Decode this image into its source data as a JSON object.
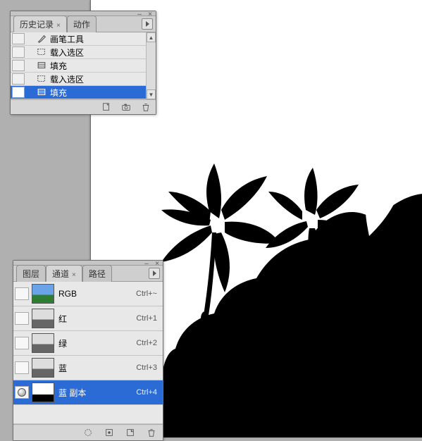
{
  "history_panel": {
    "tabs": [
      {
        "label": "历史记录",
        "active": true,
        "closeable": true
      },
      {
        "label": "动作",
        "active": false,
        "closeable": false
      }
    ],
    "items": [
      {
        "icon": "brush",
        "label": "画笔工具",
        "selected": false,
        "marker": ""
      },
      {
        "icon": "selection",
        "label": "载入选区",
        "selected": false,
        "marker": ""
      },
      {
        "icon": "fill",
        "label": "填充",
        "selected": false,
        "marker": ""
      },
      {
        "icon": "selection",
        "label": "载入选区",
        "selected": false,
        "marker": ""
      },
      {
        "icon": "fill",
        "label": "填充",
        "selected": true,
        "marker": "▶"
      }
    ],
    "footer_icons": [
      "new-doc-icon",
      "camera-icon",
      "trash-icon"
    ]
  },
  "channels_panel": {
    "tabs": [
      {
        "label": "图层",
        "active": false
      },
      {
        "label": "通道",
        "active": true,
        "closeable": true
      },
      {
        "label": "路径",
        "active": false
      }
    ],
    "items": [
      {
        "visible": false,
        "name": "RGB",
        "shortcut": "Ctrl+~",
        "selected": false,
        "thumb": "rgb"
      },
      {
        "visible": false,
        "name": "红",
        "shortcut": "Ctrl+1",
        "selected": false,
        "thumb": "gray"
      },
      {
        "visible": false,
        "name": "绿",
        "shortcut": "Ctrl+2",
        "selected": false,
        "thumb": "gray"
      },
      {
        "visible": false,
        "name": "蓝",
        "shortcut": "Ctrl+3",
        "selected": false,
        "thumb": "gray"
      },
      {
        "visible": true,
        "name": "蓝 副本",
        "shortcut": "Ctrl+4",
        "selected": true,
        "thumb": "bw"
      }
    ],
    "footer_icons": [
      "load-selection-icon",
      "save-selection-icon",
      "new-channel-icon",
      "trash-icon"
    ]
  }
}
